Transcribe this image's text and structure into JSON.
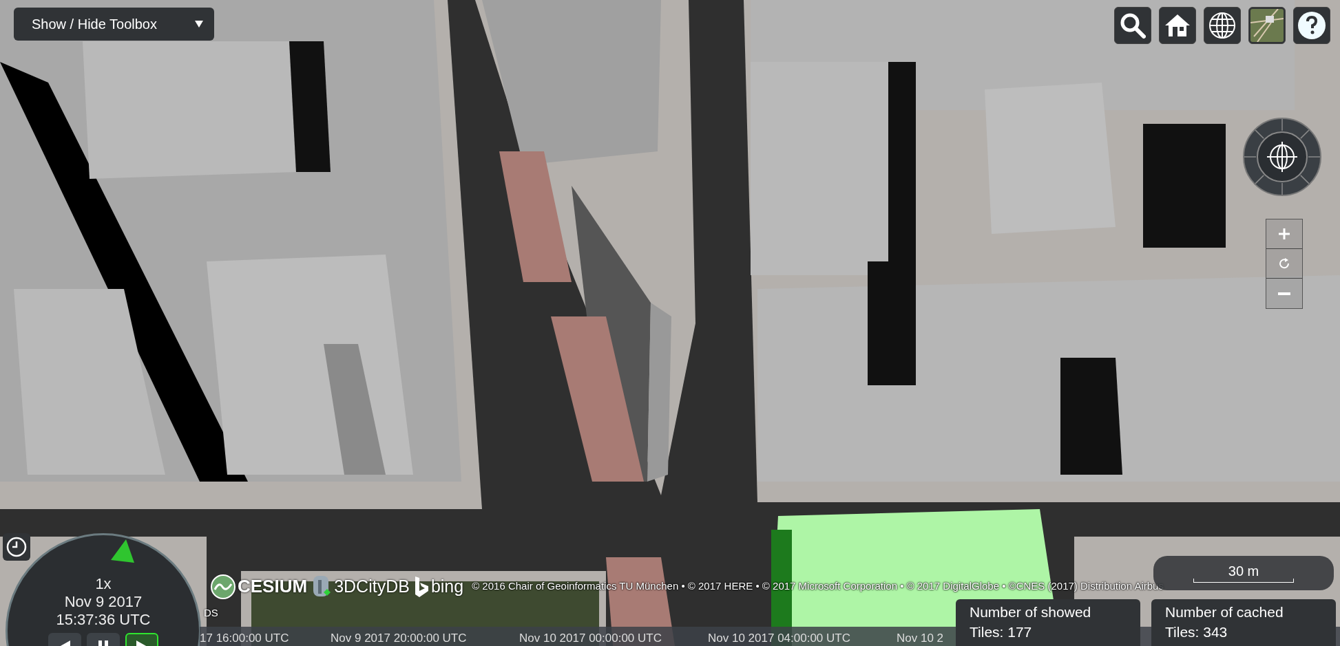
{
  "toolbox": {
    "label": "Show / Hide Toolbox"
  },
  "animation": {
    "speed": "1x",
    "date": "Nov 9 2017",
    "time": "15:37:36 UTC",
    "controls": [
      {
        "kind": "reverse",
        "selected": false
      },
      {
        "kind": "pause",
        "selected": false
      },
      {
        "kind": "play",
        "selected": true
      }
    ]
  },
  "credits": {
    "logos": [
      {
        "kind": "cesium",
        "label": "CESIUM"
      },
      {
        "kind": "citydb",
        "label": "3DCityDB"
      },
      {
        "kind": "bing",
        "label": "bing"
      }
    ],
    "text": "© 2016 Chair of Geoinformatics TU München • © 2017 HERE • © 2017 Microsoft Corporation • © 2017 DigitalGlobe • ©CNES (2017) Distribution Airbus"
  },
  "ds_label": "DS",
  "scale_bar": {
    "label": "30 m"
  },
  "timeline": {
    "labels": [
      "17 16:00:00 UTC",
      "Nov 9 2017 20:00:00 UTC",
      "Nov 10 2017 00:00:00 UTC",
      "Nov 10 2017 04:00:00 UTC",
      "Nov 10 2"
    ]
  },
  "tile_counters": [
    {
      "label": "Number of showed Tiles: 177"
    },
    {
      "label": "Number of cached Tiles: 343"
    }
  ]
}
